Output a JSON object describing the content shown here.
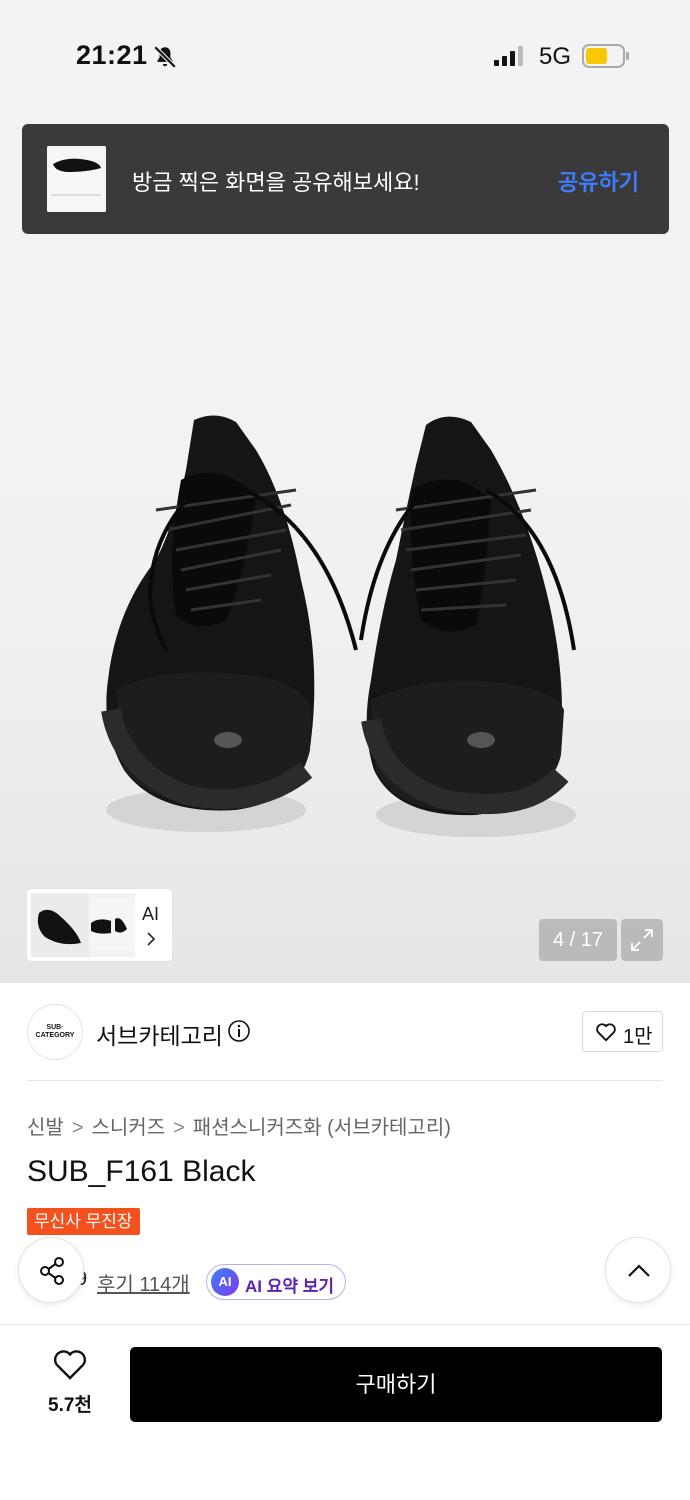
{
  "status_bar": {
    "time": "21:21",
    "network": "5G",
    "battery_level": 0.6
  },
  "toast": {
    "message": "방금 찍은 화면을 공유해보세요!",
    "action": "공유하기"
  },
  "gallery": {
    "ai_label": "AI",
    "counter": "4 / 17"
  },
  "brand": {
    "logo_line1": "SUB·",
    "logo_line2": "CATEGORY",
    "name": "서브카테고리",
    "like_count": "1만"
  },
  "breadcrumb": [
    "신발",
    "스니커즈",
    "패션스니커즈화 (서브카테고리)"
  ],
  "product": {
    "title": "SUB_F161 Black",
    "badge": "무신사 무진장",
    "rating": "9",
    "reviews": "후기 114개",
    "ai_summary_icon": "AI",
    "ai_summary": "AI 요약 보기"
  },
  "bottom_bar": {
    "wish_count": "5.7천",
    "buy_label": "구매하기"
  },
  "colors": {
    "badge": "#f4511e",
    "toast_action": "#3d7cff",
    "buy_button": "#000000",
    "battery": "#f7c800"
  },
  "icons": [
    "bell-slash-icon",
    "signal-icon",
    "battery-icon",
    "chevron-right-icon",
    "expand-icon",
    "info-icon",
    "heart-icon",
    "star-icon",
    "share-icon",
    "chevron-up-icon"
  ]
}
